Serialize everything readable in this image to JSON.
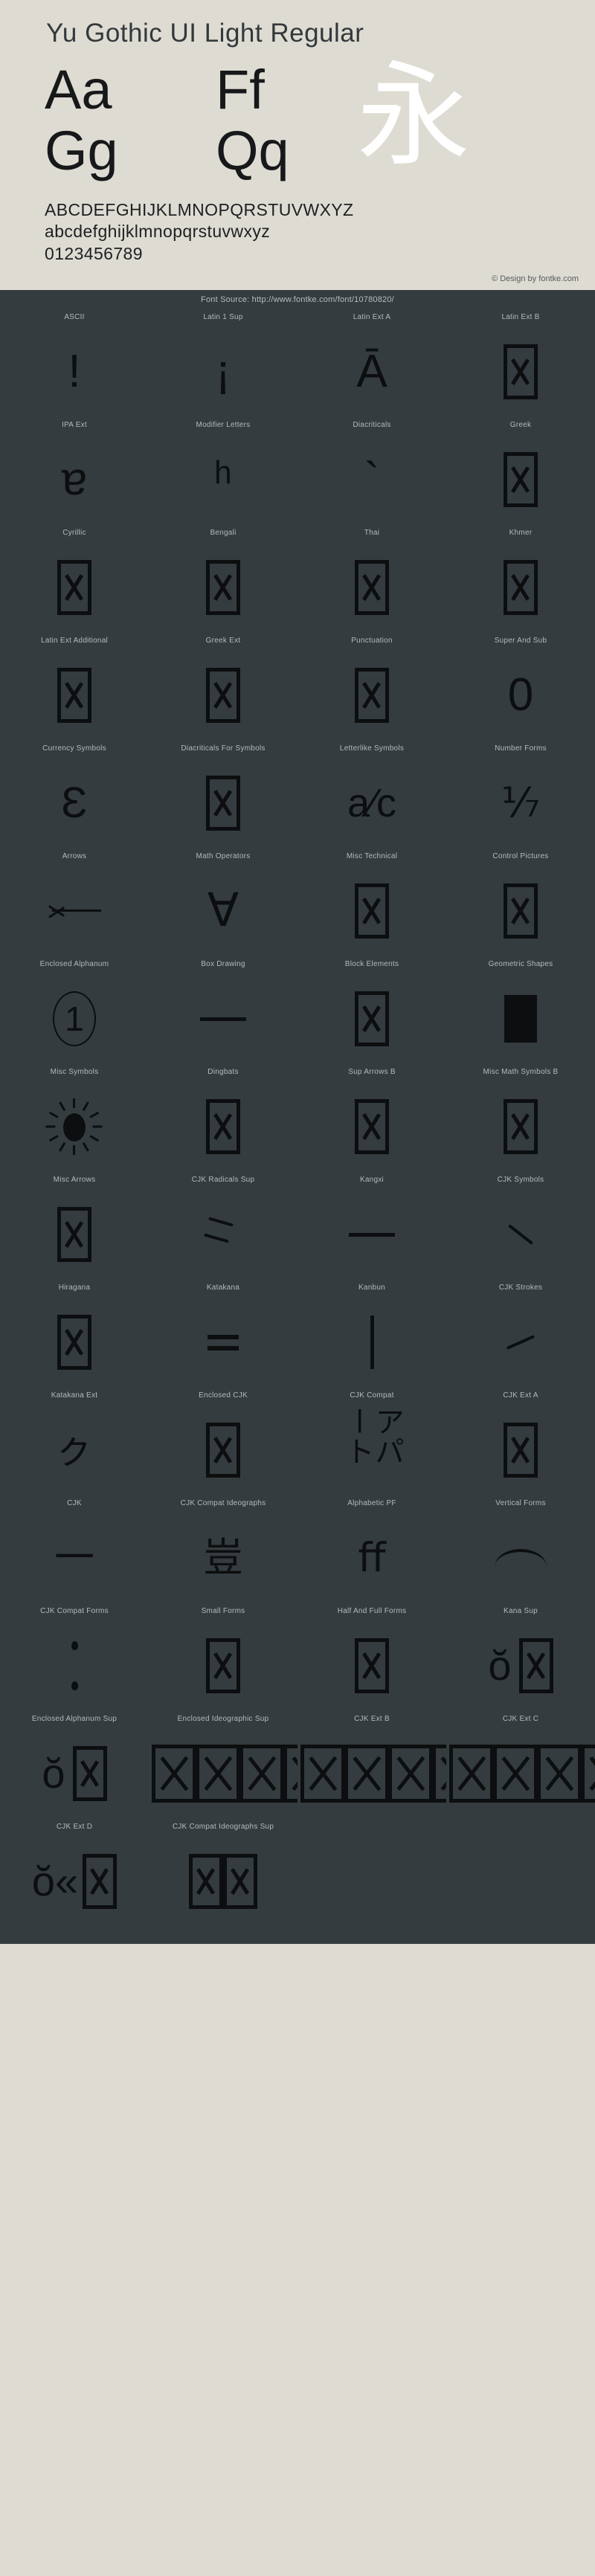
{
  "header": {
    "font_title": "Yu Gothic UI Light Regular",
    "samples": [
      {
        "name": "sample-aa",
        "text": "Aa"
      },
      {
        "name": "sample-ff",
        "text": "Ff"
      },
      {
        "name": "sample-gg",
        "text": "Gg"
      },
      {
        "name": "sample-qq",
        "text": "Qq"
      },
      {
        "name": "sample-cjk",
        "text": "永"
      }
    ],
    "alphabet_upper": "ABCDEFGHIJKLMNOPQRSTUVWXYZ",
    "alphabet_lower": "abcdefghijklmnopqrstuvwxyz",
    "digits": "0123456789",
    "credit": "© Design by fontke.com"
  },
  "source_bar": {
    "text": "Font Source: http://www.fontke.com/font/10780820/"
  },
  "colors": {
    "header_bg": "#dedbd2",
    "grid_bg": "#343c3f",
    "title_text": "#33393b",
    "glyph_dark": "#0c0e0f",
    "label_text": "#b6bab9",
    "cjk_sample": "#ffffff"
  },
  "unicode_blocks": [
    {
      "label": "ASCII",
      "sample": "!",
      "kind": "fragment"
    },
    {
      "label": "Latin 1 Sup",
      "sample": "¡",
      "kind": "fragment"
    },
    {
      "label": "Latin Ext A",
      "sample": "Ā",
      "kind": "fragment"
    },
    {
      "label": "Latin Ext B",
      "sample": "",
      "kind": "tofu"
    },
    {
      "label": "IPA Ext",
      "sample": "ɐ",
      "kind": "fragment"
    },
    {
      "label": "Modifier Letters",
      "sample": "ʰ",
      "kind": "fragment"
    },
    {
      "label": "Diacriticals",
      "sample": "`",
      "kind": "fragment"
    },
    {
      "label": "Greek",
      "sample": "",
      "kind": "tofu"
    },
    {
      "label": "Cyrillic",
      "sample": "",
      "kind": "tofu"
    },
    {
      "label": "Bengali",
      "sample": "",
      "kind": "tofu"
    },
    {
      "label": "Thai",
      "sample": "",
      "kind": "tofu"
    },
    {
      "label": "Khmer",
      "sample": "",
      "kind": "tofu"
    },
    {
      "label": "Latin Ext Additional",
      "sample": "",
      "kind": "tofu"
    },
    {
      "label": "Greek Ext",
      "sample": "",
      "kind": "tofu"
    },
    {
      "label": "Punctuation",
      "sample": "",
      "kind": "tofu"
    },
    {
      "label": "Super And Sub",
      "sample": "0",
      "kind": "fragment"
    },
    {
      "label": "Currency Symbols",
      "sample": "₠",
      "kind": "currency"
    },
    {
      "label": "Diacriticals For Symbols",
      "sample": "",
      "kind": "tofu"
    },
    {
      "label": "Letterlike Symbols",
      "sample": "a⁄c",
      "kind": "fraction"
    },
    {
      "label": "Number Forms",
      "sample": "⅐",
      "kind": "fraction"
    },
    {
      "label": "Arrows",
      "sample": "←",
      "kind": "arrow"
    },
    {
      "label": "Math Operators",
      "sample": "∀",
      "kind": "fragment"
    },
    {
      "label": "Misc Technical",
      "sample": "",
      "kind": "tofu"
    },
    {
      "label": "Control Pictures",
      "sample": "",
      "kind": "tofu"
    },
    {
      "label": "Enclosed Alphanum",
      "sample": "①",
      "kind": "circled"
    },
    {
      "label": "Box Drawing",
      "sample": "─",
      "kind": "hline"
    },
    {
      "label": "Block Elements",
      "sample": "",
      "kind": "tofu"
    },
    {
      "label": "Geometric Shapes",
      "sample": "■",
      "kind": "solid"
    },
    {
      "label": "Misc Symbols",
      "sample": "☀",
      "kind": "sun"
    },
    {
      "label": "Dingbats",
      "sample": "",
      "kind": "tofu"
    },
    {
      "label": "Sup Arrows B",
      "sample": "",
      "kind": "tofu"
    },
    {
      "label": "Misc Math Symbols B",
      "sample": "",
      "kind": "tofu"
    },
    {
      "label": "Misc Arrows",
      "sample": "",
      "kind": "tofu"
    },
    {
      "label": "CJK Radicals Sup",
      "sample": "⺀",
      "kind": "strokes"
    },
    {
      "label": "Kangxi",
      "sample": "⼀",
      "kind": "hline"
    },
    {
      "label": "CJK Symbols",
      "sample": "、",
      "kind": "diag"
    },
    {
      "label": "Hiragana",
      "sample": "",
      "kind": "tofu"
    },
    {
      "label": "Katakana",
      "sample": "゠",
      "kind": "twobars"
    },
    {
      "label": "Kanbun",
      "sample": "㆐",
      "kind": "vline"
    },
    {
      "label": "CJK Strokes",
      "sample": "㇀",
      "kind": "diagup"
    },
    {
      "label": "Katakana Ext",
      "sample": "ㇰ",
      "kind": "cjk"
    },
    {
      "label": "Enclosed CJK",
      "sample": "",
      "kind": "tofu"
    },
    {
      "label": "CJK Compat",
      "sample": "㌀",
      "kind": "cjkword"
    },
    {
      "label": "CJK Ext A",
      "sample": "",
      "kind": "tofu"
    },
    {
      "label": "CJK",
      "sample": "一",
      "kind": "cjk"
    },
    {
      "label": "CJK Compat Ideographs",
      "sample": "豈",
      "kind": "cjk"
    },
    {
      "label": "Alphabetic PF",
      "sample": "ﬀ",
      "kind": "cjk"
    },
    {
      "label": "Vertical Forms",
      "sample": "︐",
      "kind": "arc"
    },
    {
      "label": "CJK Compat Forms",
      "sample": "︙",
      "kind": "dots"
    },
    {
      "label": "Small Forms",
      "sample": "",
      "kind": "tofu"
    },
    {
      "label": "Half And Full Forms",
      "sample": "",
      "kind": "tofu"
    },
    {
      "label": "Kana Sup",
      "sample": "ŏ",
      "kind": "tofu-pair"
    },
    {
      "label": "Enclosed Alphanum Sup",
      "sample": "ŏ",
      "kind": "tofu-pair"
    },
    {
      "label": "Enclosed Ideographic Sup",
      "sample": "",
      "kind": "tofu-strip"
    },
    {
      "label": "CJK Ext B",
      "sample": "",
      "kind": "tofu-strip"
    },
    {
      "label": "CJK Ext C",
      "sample": "",
      "kind": "tofu-strip"
    },
    {
      "label": "CJK Ext D",
      "sample": "ŏ«",
      "kind": "tofu-pair2"
    },
    {
      "label": "CJK Compat Ideographs Sup",
      "sample": "",
      "kind": "tofu-double"
    }
  ]
}
